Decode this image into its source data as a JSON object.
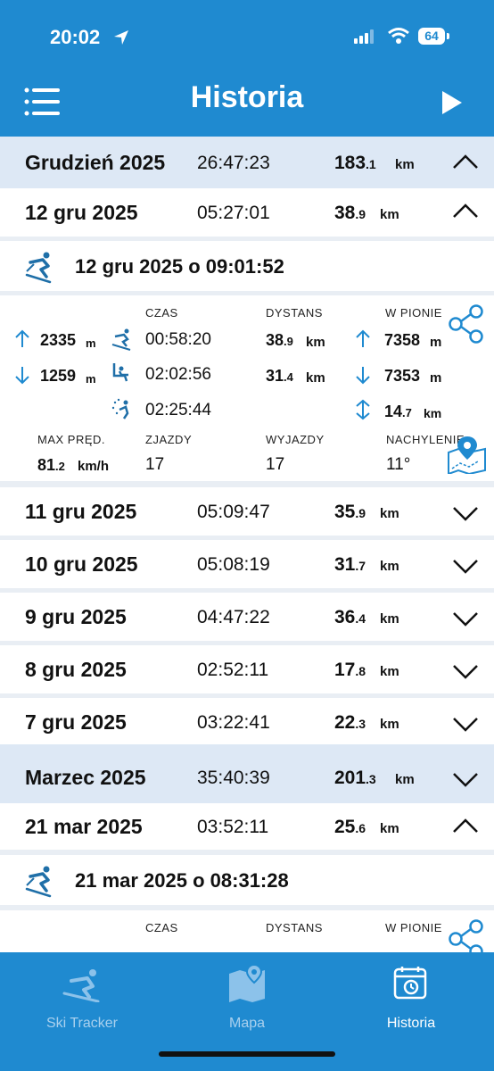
{
  "status": {
    "time": "20:02",
    "battery": "64"
  },
  "header": {
    "title": "Historia"
  },
  "months": [
    {
      "name": "Grudzień 2025",
      "time": "26:47:23",
      "dist_int": "183",
      "dist_dec": ".1",
      "unit": "km"
    },
    {
      "name": "Marzec 2025",
      "time": "35:40:39",
      "dist_int": "201",
      "dist_dec": ".3",
      "unit": "km"
    }
  ],
  "days": [
    {
      "date": "12 gru 2025",
      "time": "05:27:01",
      "dist_int": "38",
      "dist_dec": ".9",
      "unit": "km"
    },
    {
      "date": "11 gru 2025",
      "time": "05:09:47",
      "dist_int": "35",
      "dist_dec": ".9",
      "unit": "km"
    },
    {
      "date": "10 gru 2025",
      "time": "05:08:19",
      "dist_int": "31",
      "dist_dec": ".7",
      "unit": "km"
    },
    {
      "date": "9 gru 2025",
      "time": "04:47:22",
      "dist_int": "36",
      "dist_dec": ".4",
      "unit": "km"
    },
    {
      "date": "8 gru 2025",
      "time": "02:52:11",
      "dist_int": "17",
      "dist_dec": ".8",
      "unit": "km"
    },
    {
      "date": "7 gru 2025",
      "time": "03:22:41",
      "dist_int": "22",
      "dist_dec": ".3",
      "unit": "km"
    },
    {
      "date": "21 mar 2025",
      "time": "03:52:11",
      "dist_int": "25",
      "dist_dec": ".6",
      "unit": "km"
    }
  ],
  "session1": {
    "title": "12 gru 2025 o 09:01:52",
    "cap_czas": "CZAS",
    "cap_dystans": "DYSTANS",
    "cap_pion": "W PIONIE",
    "max_alt": "2335",
    "min_alt": "1259",
    "alt_unit": "m",
    "t_down": "00:58:20",
    "t_lift": "02:02:56",
    "t_other": "02:25:44",
    "d_total_int": "38",
    "d_total_dec": ".9",
    "d_ski_int": "31",
    "d_ski_dec": ".4",
    "d_unit": "km",
    "v_up": "7358",
    "v_down": "7353",
    "v_unit": "m",
    "v_diff_int": "14",
    "v_diff_dec": ".7",
    "v_diff_unit": "km",
    "cap_max": "MAX PRĘD.",
    "cap_zjazdy": "ZJAZDY",
    "cap_wyjazdy": "WYJAZDY",
    "cap_nachylenie": "NACHYLENIE",
    "max_speed_int": "81",
    "max_speed_dec": ".2",
    "speed_unit": "km/h",
    "zjazdy": "17",
    "wyjazdy": "17",
    "nachylenie": "11°"
  },
  "session2": {
    "title": "21 mar 2025 o 08:31:28",
    "cap_czas": "CZAS",
    "cap_dystans": "DYSTANS",
    "cap_pion": "W PIONIE"
  },
  "tabs": [
    {
      "label": "Ski Tracker",
      "icon": "skier-icon"
    },
    {
      "label": "Mapa",
      "icon": "map-icon"
    },
    {
      "label": "Historia",
      "icon": "calendar-icon"
    }
  ]
}
